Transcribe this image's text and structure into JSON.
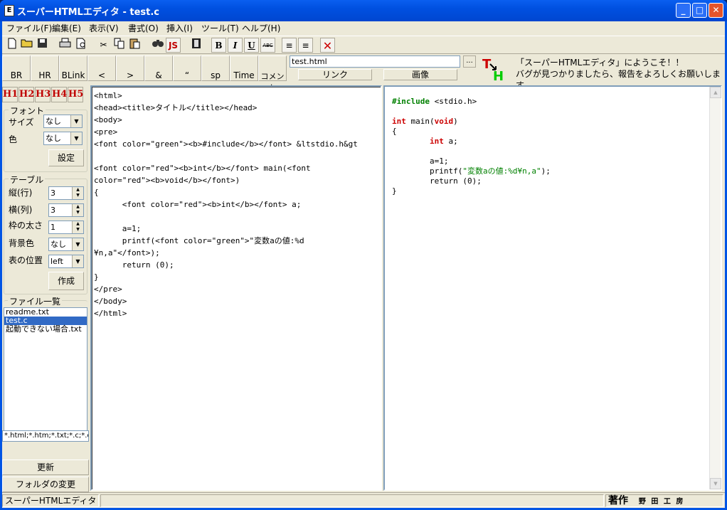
{
  "window": {
    "title": "スーパーHTMLエディタ - test.c"
  },
  "menu": [
    "ファイル(F)",
    "編集(E)",
    "表示(V)",
    "書式(O)",
    "挿入(I)",
    "ツール(T)",
    "ヘルプ(H)"
  ],
  "toolbar": {
    "bold": "B",
    "italic": "I",
    "underline": "U",
    "strike": "ABC",
    "js": "JS"
  },
  "tags": [
    "BR",
    "HR",
    "BLink",
    "<",
    ">",
    "&",
    "“",
    "sp",
    "Time",
    "コメント"
  ],
  "file_field": {
    "value": "test.html",
    "dots": "..."
  },
  "link_label": "リンク",
  "image_label": "画像",
  "welcome": {
    "line1": "「スーパーHTMLエディタ」にようこそ！！",
    "line2": "バグが見つかりましたら、報告をよろしくお願いします"
  },
  "headings": [
    "H1",
    "H2",
    "H3",
    "H4",
    "H5"
  ],
  "font_group": {
    "label": "フォント",
    "size_label": "サイズ",
    "size_value": "なし",
    "color_label": "色",
    "color_value": "なし",
    "set_button": "設定"
  },
  "table_group": {
    "label": "テーブル",
    "rows_label": "縦(行)",
    "rows_value": "3",
    "cols_label": "横(列)",
    "cols_value": "3",
    "border_label": "枠の太さ",
    "border_value": "1",
    "bg_label": "背景色",
    "bg_value": "なし",
    "pos_label": "表の位置",
    "pos_value": "left",
    "create_button": "作成"
  },
  "files": {
    "label": "ファイル一覧",
    "items": [
      "readme.txt",
      "test.c",
      "起動できない場合.txt"
    ],
    "selected": "test.c",
    "refresh_button": "更新",
    "folder_button": "フォルダの変更",
    "filter": "*.html;*.htm;*.txt;*.c;*.c"
  },
  "editor_code": "<html>\n<head><title>タイトル</title></head>\n<body>\n<pre>\n<font color=\"green\"><b>#include</b></font> &ltstdio.h&gt\n\n<font color=\"red\"><b>int</b></font> main(<font\ncolor=\"red\"><b>void</b></font>)\n{\n\t<font color=\"red\"><b>int</b></font> a;\n\n\ta=1;\n\tprintf(<font color=\"green\">\"変数aの値:%d\n¥n,a\"</font>);\n\treturn (0);\n}\n</pre>\n</body>\n</html>",
  "preview": {
    "include_kw": "#include",
    "include_rest": " <stdio.h>",
    "int_kw": "int",
    "main_mid": " main(",
    "void_kw": "void",
    "main_end": ")",
    "open_brace": "{",
    "int_kw2": "int",
    "decl_rest": " a;",
    "assign": "a=1;",
    "printf_start": "printf(",
    "printf_str": "\"変数aの値:%d¥n,a\"",
    "printf_end": ");",
    "return_line": "return (0);",
    "close_brace": "}"
  },
  "status": {
    "app_name": "スーパーHTMLエディタ",
    "author_label": "著作",
    "author_name": "野 田 工 房"
  },
  "colors": {
    "keyword_red": "#cc0000",
    "keyword_green": "#008000",
    "selection": "#316ac5"
  }
}
